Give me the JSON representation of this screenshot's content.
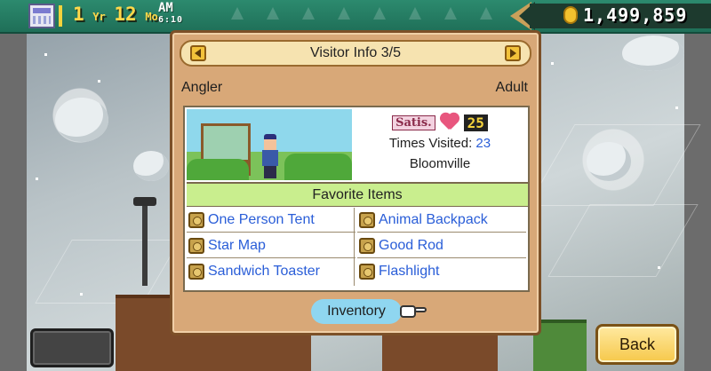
{
  "header": {
    "date_year_num": "1",
    "date_year_unit": "Yr",
    "date_month_num": "12",
    "date_month_unit": "Mo",
    "ampm": "AM",
    "time": "6:10",
    "money": "1,499,859"
  },
  "panel": {
    "title": "Visitor Info 3/5",
    "job": "Angler",
    "age_group": "Adult",
    "satisfaction_label": "Satis.",
    "satisfaction_value": "25",
    "times_visited_label": "Times Visited: ",
    "times_visited_value": "23",
    "hometown": "Bloomville",
    "favorites_title": "Favorite Items",
    "favorite_items": [
      "One Person Tent",
      "Animal Backpack",
      "Star Map",
      "Good Rod",
      "Sandwich Toaster",
      "Flashlight"
    ],
    "inventory_button": "Inventory"
  },
  "buttons": {
    "back": "Back"
  },
  "colors": {
    "panel_bg": "#d8a878",
    "favorites_header": "#c9ee8e",
    "link_blue": "#2a5ed8",
    "inventory_btn": "#8fd6f0",
    "topbar": "#2c8a6e"
  }
}
